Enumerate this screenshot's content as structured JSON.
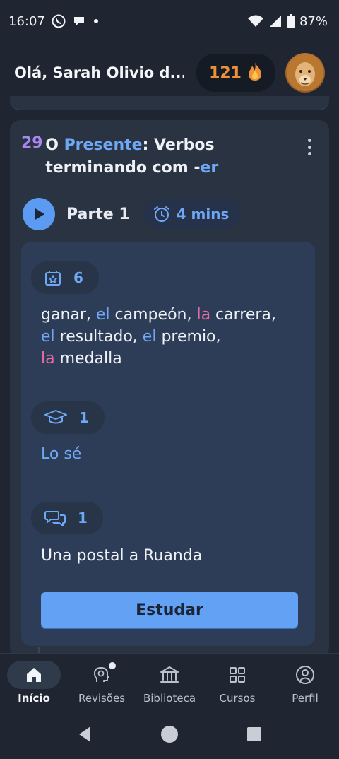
{
  "status_bar": {
    "time": "16:07",
    "battery": "87%",
    "icons": [
      "whatsapp-icon",
      "chat-bubble-icon",
      "notification-dot",
      "wifi-icon",
      "signal-icon",
      "battery-icon"
    ]
  },
  "header": {
    "greeting": "Olá, Sarah Olivio d...",
    "streak_count": "121",
    "streak_icon": "fire-icon",
    "avatar_icon": "lion-avatar"
  },
  "lesson": {
    "number": "29",
    "title_prefix": "O ",
    "title_highlight": "Presente",
    "title_middle": ": Verbos terminando com -",
    "title_suffix_hl": "er",
    "part_label": "Parte 1",
    "duration": "4 mins",
    "vocab_count": "6",
    "vocab": [
      {
        "text": "ganar, ",
        "type": "plain"
      },
      {
        "text": "el",
        "type": "m"
      },
      {
        "text": " campeón, ",
        "type": "plain"
      },
      {
        "text": "la",
        "type": "f"
      },
      {
        "text": " carrera,",
        "type": "plain"
      },
      {
        "text": "el",
        "type": "m"
      },
      {
        "text": " resultado, ",
        "type": "plain"
      },
      {
        "text": "el",
        "type": "m"
      },
      {
        "text": " premio,",
        "type": "plain"
      },
      {
        "text": "la",
        "type": "f"
      },
      {
        "text": " medalla",
        "type": "plain"
      }
    ],
    "grammar_count": "1",
    "grammar_item": "Lo sé",
    "dialog_count": "1",
    "dialog_item": "Una postal a Ruanda",
    "study_button": "Estudar"
  },
  "bottom_nav": {
    "items": [
      {
        "label": "Início",
        "icon": "home-icon",
        "active": true
      },
      {
        "label": "Revisões",
        "icon": "brain-icon",
        "active": false
      },
      {
        "label": "Biblioteca",
        "icon": "library-icon",
        "active": false
      },
      {
        "label": "Cursos",
        "icon": "grid-icon",
        "active": false
      },
      {
        "label": "Perfil",
        "icon": "profile-icon",
        "active": false
      }
    ]
  },
  "colors": {
    "accent": "#6ea8f6",
    "masculine": "#6ea8f6",
    "feminine": "#e86aa6",
    "streak": "#f0913a",
    "lesson_number": "#a886f0"
  }
}
